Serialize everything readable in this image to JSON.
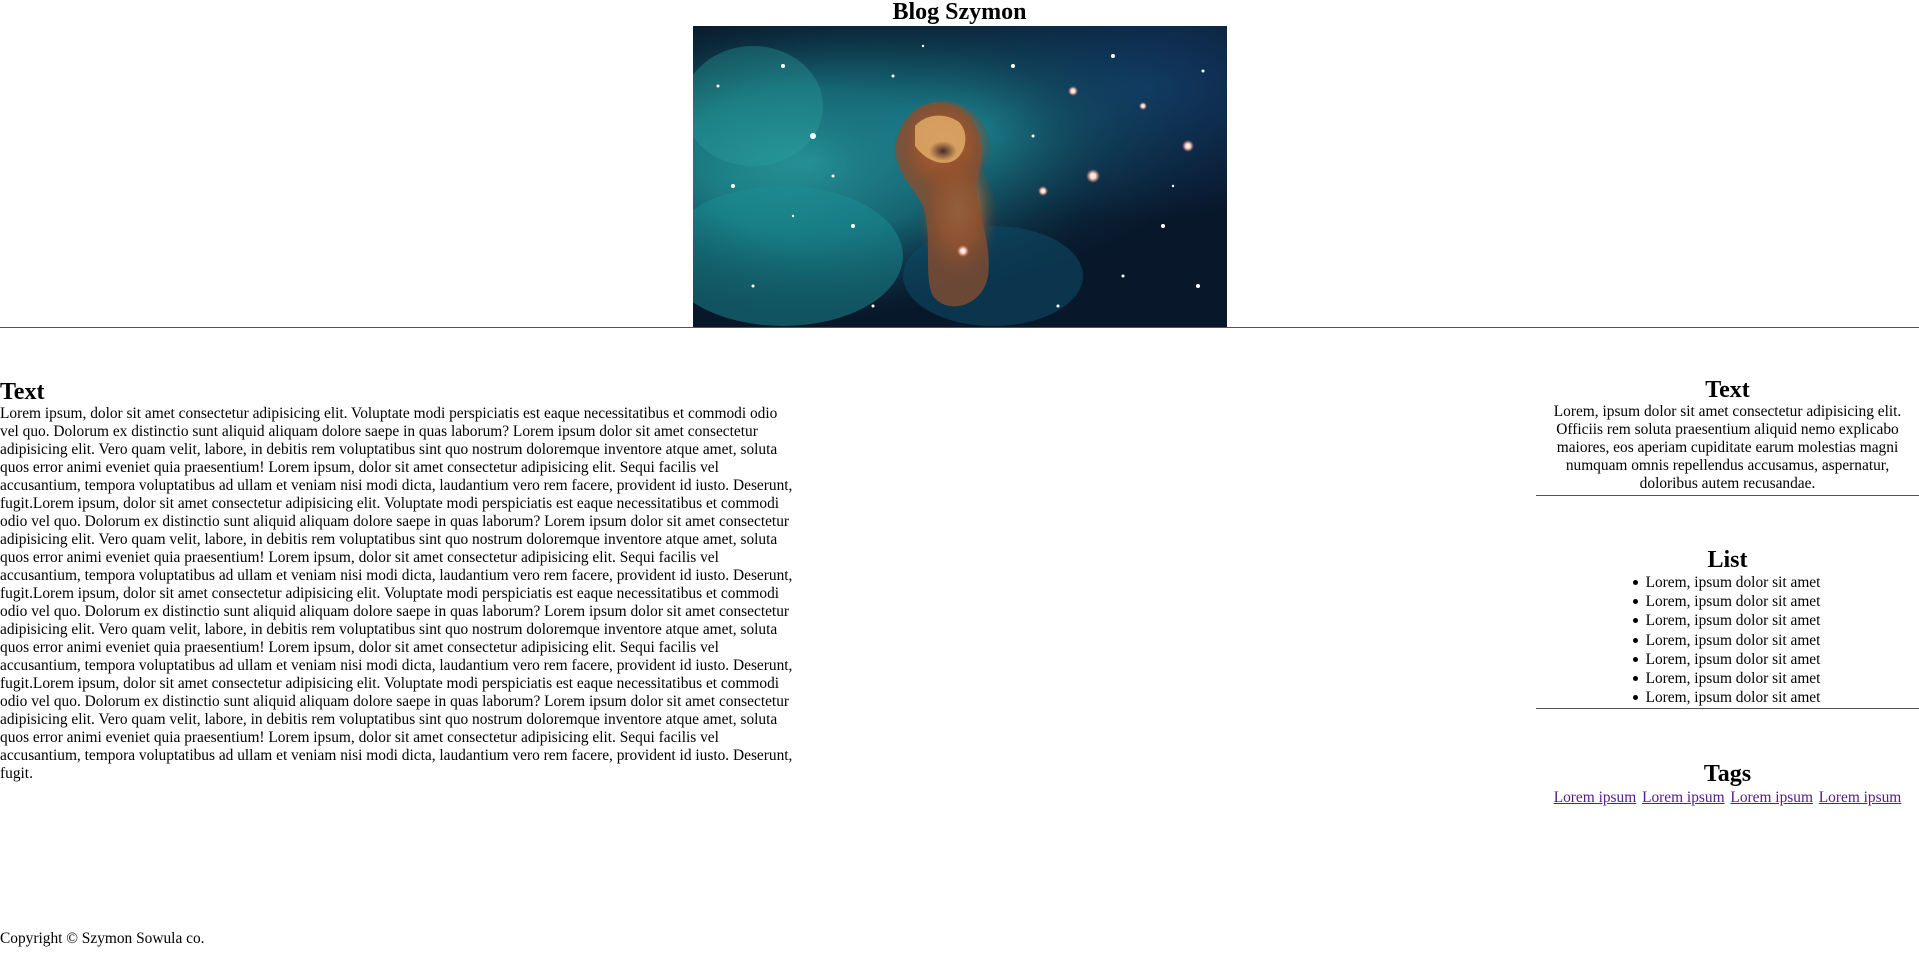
{
  "header": {
    "title": "Blog Szymon",
    "hero_image": "nebula-image"
  },
  "article": {
    "heading": "Text",
    "body": "Lorem ipsum, dolor sit amet consectetur adipisicing elit. Voluptate modi perspiciatis est eaque necessitatibus et commodi odio vel quo. Dolorum ex distinctio sunt aliquid aliquam dolore saepe in quas laborum? Lorem ipsum dolor sit amet consectetur adipisicing elit. Vero quam velit, labore, in debitis rem voluptatibus sint quo nostrum doloremque inventore atque amet, soluta quos error animi eveniet quia praesentium! Lorem ipsum, dolor sit amet consectetur adipisicing elit. Sequi facilis vel accusantium, tempora voluptatibus ad ullam et veniam nisi modi dicta, laudantium vero rem facere, provident id iusto. Deserunt, fugit.Lorem ipsum, dolor sit amet consectetur adipisicing elit. Voluptate modi perspiciatis est eaque necessitatibus et commodi odio vel quo. Dolorum ex distinctio sunt aliquid aliquam dolore saepe in quas laborum? Lorem ipsum dolor sit amet consectetur adipisicing elit. Vero quam velit, labore, in debitis rem voluptatibus sint quo nostrum doloremque inventore atque amet, soluta quos error animi eveniet quia praesentium! Lorem ipsum, dolor sit amet consectetur adipisicing elit. Sequi facilis vel accusantium, tempora voluptatibus ad ullam et veniam nisi modi dicta, laudantium vero rem facere, provident id iusto. Deserunt, fugit.Lorem ipsum, dolor sit amet consectetur adipisicing elit. Voluptate modi perspiciatis est eaque necessitatibus et commodi odio vel quo. Dolorum ex distinctio sunt aliquid aliquam dolore saepe in quas laborum? Lorem ipsum dolor sit amet consectetur adipisicing elit. Vero quam velit, labore, in debitis rem voluptatibus sint quo nostrum doloremque inventore atque amet, soluta quos error animi eveniet quia praesentium! Lorem ipsum, dolor sit amet consectetur adipisicing elit. Sequi facilis vel accusantium, tempora voluptatibus ad ullam et veniam nisi modi dicta, laudantium vero rem facere, provident id iusto. Deserunt, fugit.Lorem ipsum, dolor sit amet consectetur adipisicing elit. Voluptate modi perspiciatis est eaque necessitatibus et commodi odio vel quo. Dolorum ex distinctio sunt aliquid aliquam dolore saepe in quas laborum? Lorem ipsum dolor sit amet consectetur adipisicing elit. Vero quam velit, labore, in debitis rem voluptatibus sint quo nostrum doloremque inventore atque amet, soluta quos error animi eveniet quia praesentium! Lorem ipsum, dolor sit amet consectetur adipisicing elit. Sequi facilis vel accusantium, tempora voluptatibus ad ullam et veniam nisi modi dicta, laudantium vero rem facere, provident id iusto. Deserunt, fugit."
  },
  "sidebar": {
    "text_block": {
      "heading": "Text",
      "body": "Lorem, ipsum dolor sit amet consectetur adipisicing elit. Officiis rem soluta praesentium aliquid nemo explicabo maiores, eos aperiam cupiditate earum molestias magni numquam omnis repellendus accusamus, aspernatur, doloribus autem recusandae."
    },
    "list_block": {
      "heading": "List",
      "items": [
        "Lorem, ipsum dolor sit amet",
        "Lorem, ipsum dolor sit amet",
        "Lorem, ipsum dolor sit amet",
        "Lorem, ipsum dolor sit amet",
        "Lorem, ipsum dolor sit amet",
        "Lorem, ipsum dolor sit amet",
        "Lorem, ipsum dolor sit amet"
      ]
    },
    "tags_block": {
      "heading": "Tags",
      "tags": [
        "Lorem ipsum",
        "Lorem ipsum",
        "Lorem ipsum",
        "Lorem ipsum"
      ]
    }
  },
  "footer": {
    "copyright": "Copyright © Szymon Sowula co."
  },
  "colors": {
    "link_visited": "#551a8b",
    "divider": "#555555"
  }
}
